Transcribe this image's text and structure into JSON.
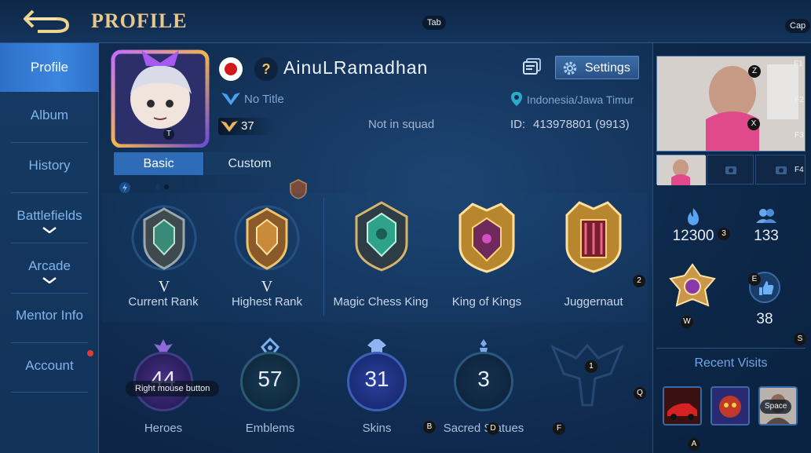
{
  "header": {
    "title": "PROFILE",
    "tab_hint": "Tab",
    "cap_hint": "Cap"
  },
  "sidebar": {
    "items": [
      {
        "label": "Profile"
      },
      {
        "label": "Album"
      },
      {
        "label": "History"
      },
      {
        "label": "Battlefields"
      },
      {
        "label": "Arcade"
      },
      {
        "label": "Mentor Info"
      },
      {
        "label": "Account"
      }
    ]
  },
  "player": {
    "name": "AinuLRamadhan",
    "title": "No Title",
    "level": "37",
    "squad": "Not in squad",
    "location": "Indonesia/Jawa Timur",
    "id_label": "ID:",
    "id_value": "413978801 (9913)",
    "unknown_mark": "?",
    "avatar_hint": "T"
  },
  "toolbar": {
    "settings_label": "Settings"
  },
  "tabs": [
    {
      "label": "Basic"
    },
    {
      "label": "Custom"
    }
  ],
  "ranks": [
    {
      "label": "Current Rank",
      "tier": "V"
    },
    {
      "label": "Highest Rank",
      "tier": "V"
    },
    {
      "label": "Magic Chess King",
      "tier": ""
    },
    {
      "label": "King of Kings",
      "tier": ""
    },
    {
      "label": "Juggernaut",
      "tier": ""
    }
  ],
  "stats": [
    {
      "label": "Heroes",
      "value": "44"
    },
    {
      "label": "Emblems",
      "value": "57"
    },
    {
      "label": "Skins",
      "value": "31"
    },
    {
      "label": "Sacred Statues",
      "value": "3"
    }
  ],
  "right_panel": {
    "popularity": "12300",
    "followers": "133",
    "likes": "38",
    "recent_visits_title": "Recent Visits"
  },
  "key_hints": {
    "z": "Z",
    "x": "X",
    "f1": "F1",
    "f2": "F2",
    "f3": "F3",
    "f4": "F4",
    "three": "3",
    "two": "2",
    "one": "1",
    "e": "E",
    "w": "W",
    "s": "S",
    "q": "Q",
    "a": "A",
    "b": "B",
    "d": "D",
    "f": "F",
    "space": "Space",
    "rmb": "Right mouse button"
  },
  "colors": {
    "title_gold": "#e9c68a",
    "active_tab": "#2f6cb8",
    "sidebar_active": "#3b86e0",
    "sidebar_text": "#7fb5ea"
  }
}
